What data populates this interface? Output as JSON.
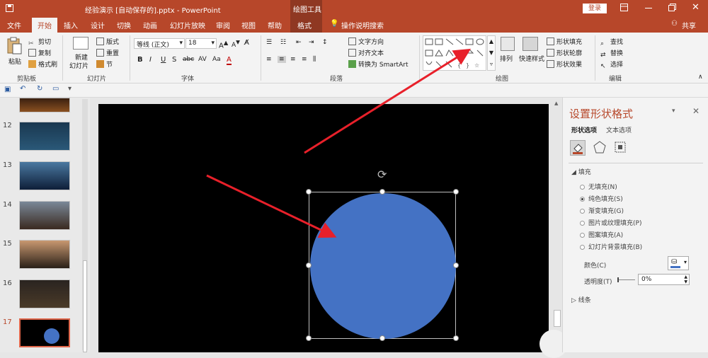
{
  "titlebar": {
    "doc_title": "经验演示 [自动保存的].pptx  -  PowerPoint",
    "tool_context": "绘图工具",
    "signin": "登录",
    "share": "共享"
  },
  "tabs": [
    "文件",
    "开始",
    "插入",
    "设计",
    "切换",
    "动画",
    "幻灯片放映",
    "审阅",
    "视图",
    "帮助",
    "格式"
  ],
  "tell_me": "操作说明搜索",
  "ribbon": {
    "clipboard": {
      "paste": "粘贴",
      "cut": "剪切",
      "copy": "复制",
      "format_painter": "格式刷",
      "label": "剪贴板"
    },
    "slides": {
      "new_slide": "新建",
      "new_slide2": "幻灯片",
      "layout": "版式",
      "reset": "重置",
      "section": "节",
      "label": "幻灯片"
    },
    "font": {
      "font_name": "等线 (正文)",
      "font_size": "18",
      "label": "字体"
    },
    "paragraph": {
      "text_direction": "文字方向",
      "align_text": "对齐文本",
      "smartart": "转换为 SmartArt",
      "label": "段落"
    },
    "drawing": {
      "arrange": "排列",
      "quick_styles": "快速样式",
      "shape_fill": "形状填充",
      "shape_outline": "形状轮廓",
      "shape_effects": "形状效果",
      "label": "绘图"
    },
    "editing": {
      "find": "查找",
      "replace": "替换",
      "select": "选择",
      "label": "编辑"
    }
  },
  "thumbnails": [
    {
      "num": "12"
    },
    {
      "num": "13"
    },
    {
      "num": "14"
    },
    {
      "num": "15"
    },
    {
      "num": "16"
    },
    {
      "num": "17"
    }
  ],
  "format_pane": {
    "title": "设置形状格式",
    "tab_shape": "形状选项",
    "tab_text": "文本选项",
    "section_fill": "填充",
    "options": [
      "无填充(N)",
      "纯色填充(S)",
      "渐变填充(G)",
      "图片或纹理填充(P)",
      "图案填充(A)",
      "幻灯片背景填充(B)"
    ],
    "selected_option": 1,
    "color_label": "颜色(C)",
    "transparency_label": "透明度(T)",
    "transparency_value": "0%",
    "section_line": "线条"
  },
  "colors": {
    "accent": "#b7472a",
    "shape_fill": "#4472c4",
    "arrow": "#e8202a"
  }
}
